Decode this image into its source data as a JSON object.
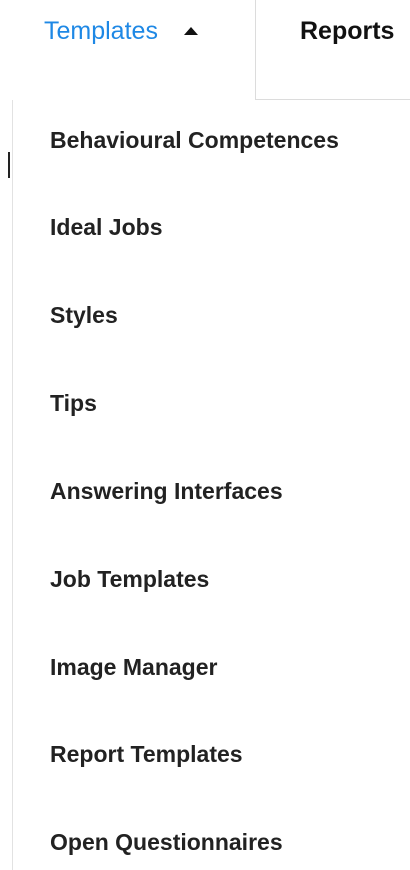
{
  "tabs": {
    "templates_label": "Templates",
    "reports_label": "Reports"
  },
  "menu": {
    "items": [
      {
        "label": "Behavioural Competences"
      },
      {
        "label": "Ideal Jobs"
      },
      {
        "label": "Styles"
      },
      {
        "label": "Tips"
      },
      {
        "label": "Answering Interfaces"
      },
      {
        "label": "Job Templates"
      },
      {
        "label": "Image Manager"
      },
      {
        "label": "Report Templates"
      },
      {
        "label": "Open Questionnaires"
      }
    ]
  },
  "colors": {
    "active_tab": "#1e88e5",
    "menu_text": "#222222"
  },
  "icons": {
    "templates_caret": "caret-up-icon"
  }
}
